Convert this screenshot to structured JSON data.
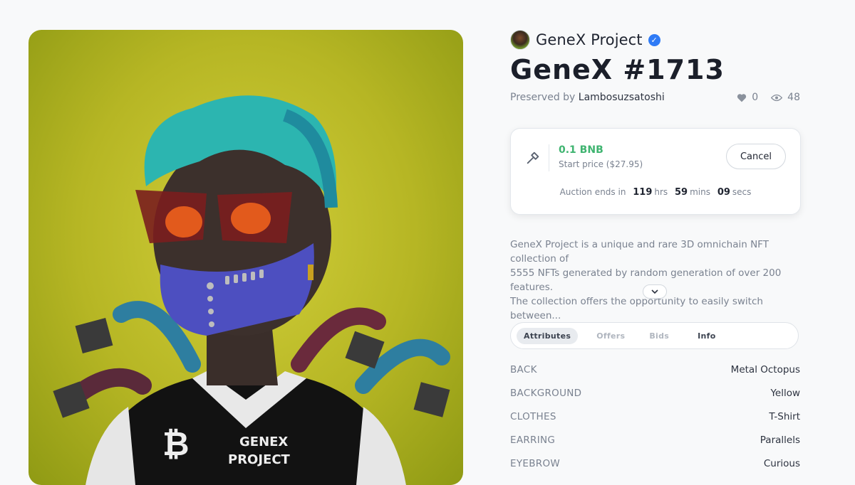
{
  "collection": {
    "name": "GeneX Project",
    "verified": true,
    "avatar": "collection-avatar"
  },
  "nft": {
    "title": "GeneX #1713",
    "owner_prefix": "Preserved by",
    "owner_name": "Lambosuzsatoshi",
    "likes": "0",
    "views": "48",
    "image_text": {
      "bitcoin_symbol": "₿",
      "shirt_line1": "GENEX",
      "shirt_line2": "PROJECT"
    }
  },
  "auction": {
    "price": "0.1 BNB",
    "start_price": "Start price ($27.95)",
    "cancel_label": "Cancel",
    "ends_label": "Auction ends in",
    "hours": "119",
    "hours_unit": "hrs",
    "mins": "59",
    "mins_unit": "mins",
    "secs": "09",
    "secs_unit": "secs"
  },
  "description": {
    "line1": "GeneX Project is a unique and rare 3D omnichain NFT collection of",
    "line2": "5555 NFTs generated by random generation of over 200 features.",
    "line3": "The collection offers the opportunity to easily switch between..."
  },
  "tabs": [
    {
      "label": "Attributes",
      "active": true
    },
    {
      "label": "Offers"
    },
    {
      "label": "Bids"
    },
    {
      "label": "Info"
    }
  ],
  "attributes": [
    {
      "key": "BACK",
      "value": "Metal Octopus"
    },
    {
      "key": "BACKGROUND",
      "value": "Yellow"
    },
    {
      "key": "CLOTHES",
      "value": "T-Shirt"
    },
    {
      "key": "EARRING",
      "value": "Parallels"
    },
    {
      "key": "EYEBROW",
      "value": "Curious"
    }
  ],
  "colors": {
    "price_green": "#3fb470",
    "verified_blue": "#2f7bf6",
    "art_background": "#b6b624"
  }
}
